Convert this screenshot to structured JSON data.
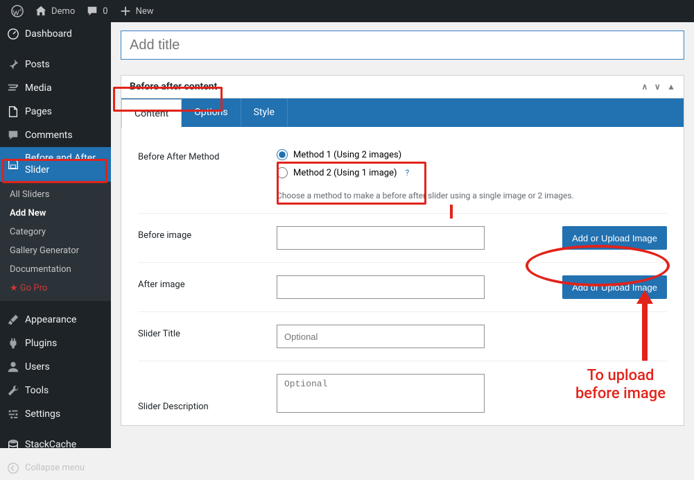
{
  "adminbar": {
    "site": "Demo",
    "comments": "0",
    "new": "New"
  },
  "sidebar": {
    "items": [
      {
        "label": "Dashboard",
        "icon": "dashboard"
      },
      {
        "label": "Posts",
        "icon": "pin"
      },
      {
        "label": "Media",
        "icon": "media"
      },
      {
        "label": "Pages",
        "icon": "pages"
      },
      {
        "label": "Comments",
        "icon": "comments"
      },
      {
        "label": "Before and After Slider",
        "icon": "disk",
        "active": true
      }
    ],
    "submenu": [
      {
        "label": "All Sliders"
      },
      {
        "label": "Add New",
        "bold": true
      },
      {
        "label": "Category"
      },
      {
        "label": "Gallery Generator"
      },
      {
        "label": "Documentation"
      },
      {
        "label": "★ Go Pro",
        "star": true
      }
    ],
    "items2": [
      {
        "label": "Appearance",
        "icon": "brush"
      },
      {
        "label": "Plugins",
        "icon": "plugin"
      },
      {
        "label": "Users",
        "icon": "user"
      },
      {
        "label": "Tools",
        "icon": "wrench"
      },
      {
        "label": "Settings",
        "icon": "settings"
      },
      {
        "label": "StackCache",
        "icon": "stack"
      }
    ],
    "collapse": "Collapse menu"
  },
  "editor": {
    "title_placeholder": "Add title"
  },
  "metabox": {
    "title": "Before after content",
    "tabs": [
      "Content",
      "Options",
      "Style"
    ],
    "fields": {
      "method_label": "Before After Method",
      "method1": "Method 1 (Using 2 images)",
      "method2": "Method 2 (Using 1 image)",
      "method_help": "?",
      "method_desc": "Choose a method to make a before after slider using a single image or 2 images.",
      "before_label": "Before image",
      "after_label": "After image",
      "upload_btn": "Add or Upload Image",
      "slider_title_label": "Slider Title",
      "slider_title_ph": "Optional",
      "slider_desc_label": "Slider Description",
      "slider_desc_ph": "Optional"
    }
  },
  "annotations": {
    "callout": "To upload\nbefore image"
  }
}
